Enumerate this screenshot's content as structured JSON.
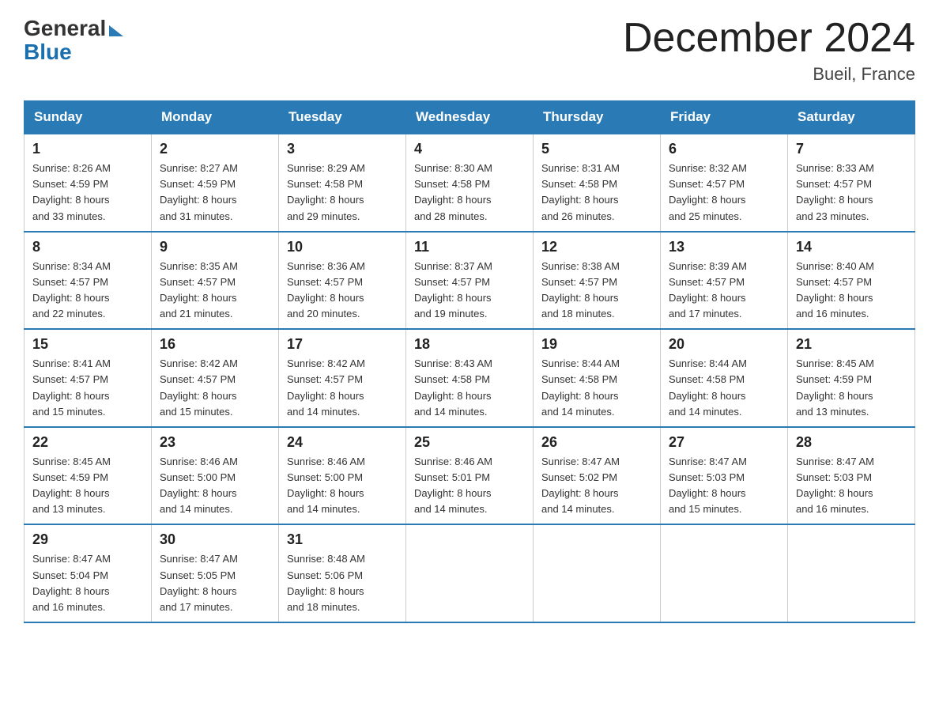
{
  "header": {
    "logo": {
      "general": "General",
      "blue": "Blue"
    },
    "title": "December 2024",
    "location": "Bueil, France"
  },
  "columns": [
    "Sunday",
    "Monday",
    "Tuesday",
    "Wednesday",
    "Thursday",
    "Friday",
    "Saturday"
  ],
  "weeks": [
    [
      {
        "day": "1",
        "sunrise": "8:26 AM",
        "sunset": "4:59 PM",
        "daylight": "8 hours and 33 minutes."
      },
      {
        "day": "2",
        "sunrise": "8:27 AM",
        "sunset": "4:59 PM",
        "daylight": "8 hours and 31 minutes."
      },
      {
        "day": "3",
        "sunrise": "8:29 AM",
        "sunset": "4:58 PM",
        "daylight": "8 hours and 29 minutes."
      },
      {
        "day": "4",
        "sunrise": "8:30 AM",
        "sunset": "4:58 PM",
        "daylight": "8 hours and 28 minutes."
      },
      {
        "day": "5",
        "sunrise": "8:31 AM",
        "sunset": "4:58 PM",
        "daylight": "8 hours and 26 minutes."
      },
      {
        "day": "6",
        "sunrise": "8:32 AM",
        "sunset": "4:57 PM",
        "daylight": "8 hours and 25 minutes."
      },
      {
        "day": "7",
        "sunrise": "8:33 AM",
        "sunset": "4:57 PM",
        "daylight": "8 hours and 23 minutes."
      }
    ],
    [
      {
        "day": "8",
        "sunrise": "8:34 AM",
        "sunset": "4:57 PM",
        "daylight": "8 hours and 22 minutes."
      },
      {
        "day": "9",
        "sunrise": "8:35 AM",
        "sunset": "4:57 PM",
        "daylight": "8 hours and 21 minutes."
      },
      {
        "day": "10",
        "sunrise": "8:36 AM",
        "sunset": "4:57 PM",
        "daylight": "8 hours and 20 minutes."
      },
      {
        "day": "11",
        "sunrise": "8:37 AM",
        "sunset": "4:57 PM",
        "daylight": "8 hours and 19 minutes."
      },
      {
        "day": "12",
        "sunrise": "8:38 AM",
        "sunset": "4:57 PM",
        "daylight": "8 hours and 18 minutes."
      },
      {
        "day": "13",
        "sunrise": "8:39 AM",
        "sunset": "4:57 PM",
        "daylight": "8 hours and 17 minutes."
      },
      {
        "day": "14",
        "sunrise": "8:40 AM",
        "sunset": "4:57 PM",
        "daylight": "8 hours and 16 minutes."
      }
    ],
    [
      {
        "day": "15",
        "sunrise": "8:41 AM",
        "sunset": "4:57 PM",
        "daylight": "8 hours and 15 minutes."
      },
      {
        "day": "16",
        "sunrise": "8:42 AM",
        "sunset": "4:57 PM",
        "daylight": "8 hours and 15 minutes."
      },
      {
        "day": "17",
        "sunrise": "8:42 AM",
        "sunset": "4:57 PM",
        "daylight": "8 hours and 14 minutes."
      },
      {
        "day": "18",
        "sunrise": "8:43 AM",
        "sunset": "4:58 PM",
        "daylight": "8 hours and 14 minutes."
      },
      {
        "day": "19",
        "sunrise": "8:44 AM",
        "sunset": "4:58 PM",
        "daylight": "8 hours and 14 minutes."
      },
      {
        "day": "20",
        "sunrise": "8:44 AM",
        "sunset": "4:58 PM",
        "daylight": "8 hours and 14 minutes."
      },
      {
        "day": "21",
        "sunrise": "8:45 AM",
        "sunset": "4:59 PM",
        "daylight": "8 hours and 13 minutes."
      }
    ],
    [
      {
        "day": "22",
        "sunrise": "8:45 AM",
        "sunset": "4:59 PM",
        "daylight": "8 hours and 13 minutes."
      },
      {
        "day": "23",
        "sunrise": "8:46 AM",
        "sunset": "5:00 PM",
        "daylight": "8 hours and 14 minutes."
      },
      {
        "day": "24",
        "sunrise": "8:46 AM",
        "sunset": "5:00 PM",
        "daylight": "8 hours and 14 minutes."
      },
      {
        "day": "25",
        "sunrise": "8:46 AM",
        "sunset": "5:01 PM",
        "daylight": "8 hours and 14 minutes."
      },
      {
        "day": "26",
        "sunrise": "8:47 AM",
        "sunset": "5:02 PM",
        "daylight": "8 hours and 14 minutes."
      },
      {
        "day": "27",
        "sunrise": "8:47 AM",
        "sunset": "5:03 PM",
        "daylight": "8 hours and 15 minutes."
      },
      {
        "day": "28",
        "sunrise": "8:47 AM",
        "sunset": "5:03 PM",
        "daylight": "8 hours and 16 minutes."
      }
    ],
    [
      {
        "day": "29",
        "sunrise": "8:47 AM",
        "sunset": "5:04 PM",
        "daylight": "8 hours and 16 minutes."
      },
      {
        "day": "30",
        "sunrise": "8:47 AM",
        "sunset": "5:05 PM",
        "daylight": "8 hours and 17 minutes."
      },
      {
        "day": "31",
        "sunrise": "8:48 AM",
        "sunset": "5:06 PM",
        "daylight": "8 hours and 18 minutes."
      },
      null,
      null,
      null,
      null
    ]
  ],
  "labels": {
    "sunrise": "Sunrise:",
    "sunset": "Sunset:",
    "daylight": "Daylight:"
  }
}
